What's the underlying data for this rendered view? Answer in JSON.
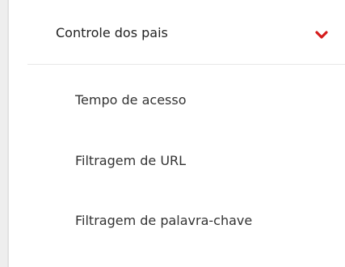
{
  "menu": {
    "section_title": "Controle dos pais",
    "expand_icon": "chevron-down-icon",
    "accent_color": "#d51c1c",
    "items": [
      {
        "label": "Tempo de acesso"
      },
      {
        "label": "Filtragem de URL"
      },
      {
        "label": "Filtragem de palavra-chave"
      }
    ]
  }
}
